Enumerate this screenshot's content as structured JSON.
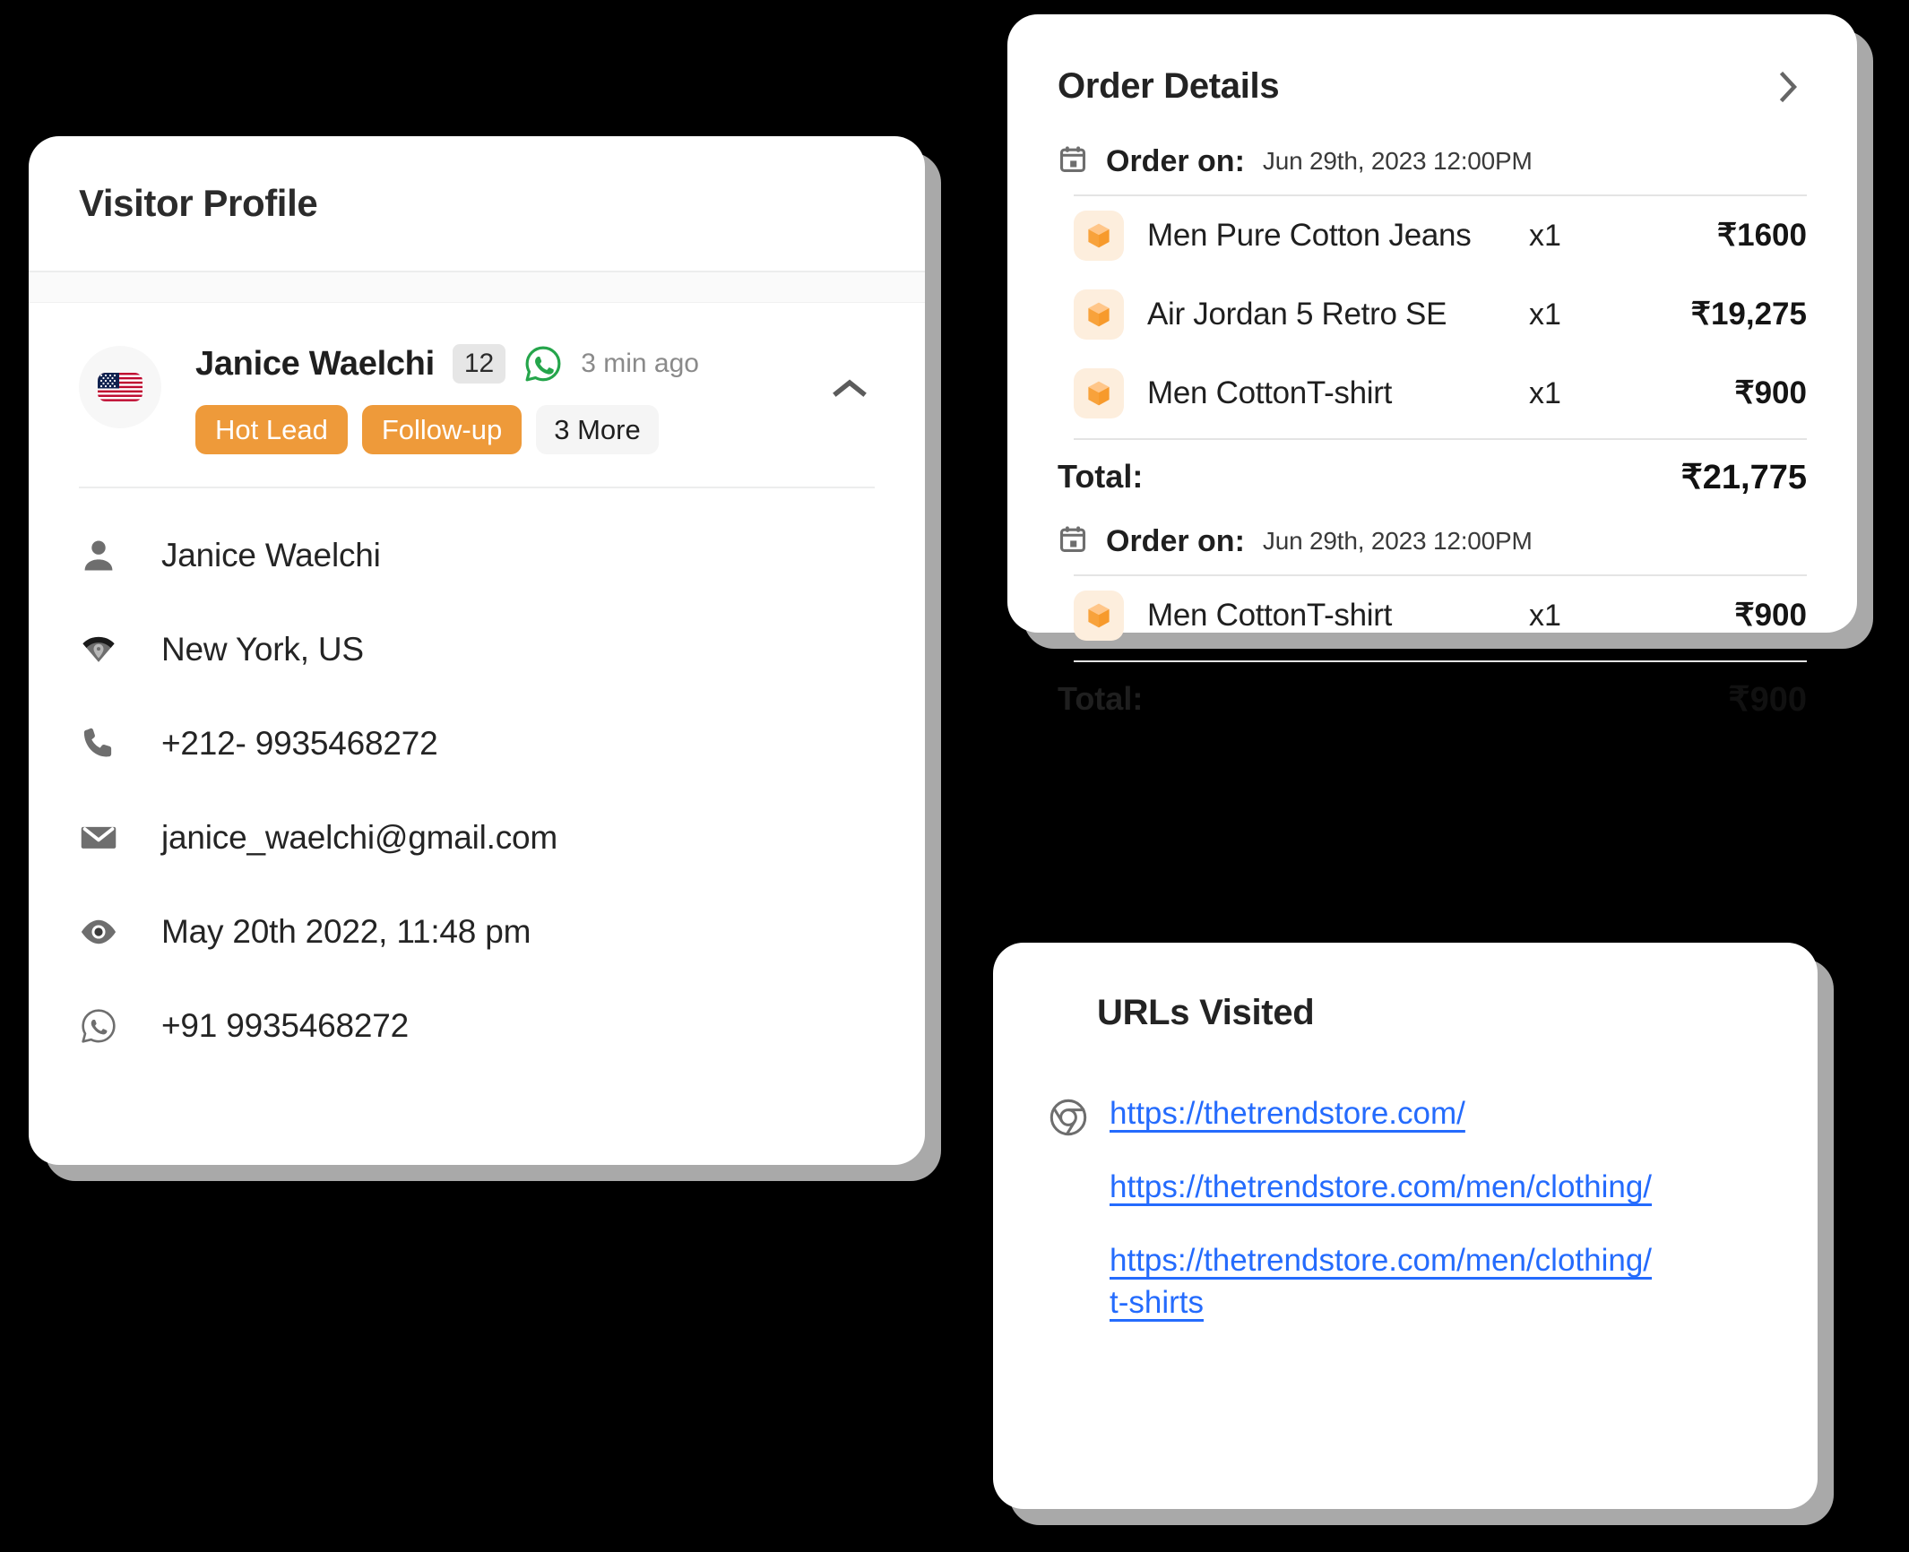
{
  "visitor_profile": {
    "title": "Visitor Profile",
    "avatar_flag": "us-flag-icon",
    "name": "Janice Waelchi",
    "message_count": "12",
    "channel_icon": "whatsapp-icon",
    "time_ago": "3 min ago",
    "tags": [
      "Hot Lead",
      "Follow-up"
    ],
    "more_tags_label": "3 More",
    "collapse_icon": "chevron-up-icon",
    "details": [
      {
        "icon": "person-icon",
        "value": "Janice Waelchi"
      },
      {
        "icon": "location-pin-icon",
        "value": "New York, US"
      },
      {
        "icon": "phone-icon",
        "value": "+212- 9935468272"
      },
      {
        "icon": "envelope-icon",
        "value": "janice_waelchi@gmail.com"
      },
      {
        "icon": "eye-icon",
        "value": "May 20th 2022, 11:48 pm"
      },
      {
        "icon": "whatsapp-icon",
        "value": "+91 9935468272"
      }
    ]
  },
  "order_details": {
    "title": "Order Details",
    "expand_icon": "chevron-right-icon",
    "order_on_label": "Order on:",
    "total_label": "Total:",
    "orders": [
      {
        "date": "Jun 29th, 2023 12:00PM",
        "items": [
          {
            "icon": "package-icon",
            "name": "Men Pure Cotton Jeans",
            "qty": "x1",
            "price": "₹1600"
          },
          {
            "icon": "package-icon",
            "name": "Air Jordan 5 Retro SE",
            "qty": "x1",
            "price": "₹19,275"
          },
          {
            "icon": "package-icon",
            "name": "Men CottonT-shirt",
            "qty": "x1",
            "price": "₹900"
          }
        ],
        "total": "₹21,775"
      },
      {
        "date": "Jun 29th, 2023 12:00PM",
        "items": [
          {
            "icon": "package-icon",
            "name": "Men CottonT-shirt",
            "qty": "x1",
            "price": "₹900"
          }
        ],
        "total": "₹900"
      }
    ]
  },
  "urls_visited": {
    "title": "URLs Visited",
    "browser_icon": "chrome-icon",
    "urls": [
      "https://thetrendstore.com/",
      "https://thetrendstore.com/men/clothing/",
      "https://thetrendstore.com/men/clothing/t-shirts"
    ]
  },
  "colors": {
    "background": "#000000",
    "card": "#ffffff",
    "shadow": "#a9a9a9",
    "tag_orange": "#ee9a3a",
    "link_blue": "#246bfd",
    "whatsapp_green": "#25a54b",
    "package_orange": "#f8a23b",
    "package_bg": "#fdeedd",
    "badge_gray": "#e6e6e6"
  }
}
